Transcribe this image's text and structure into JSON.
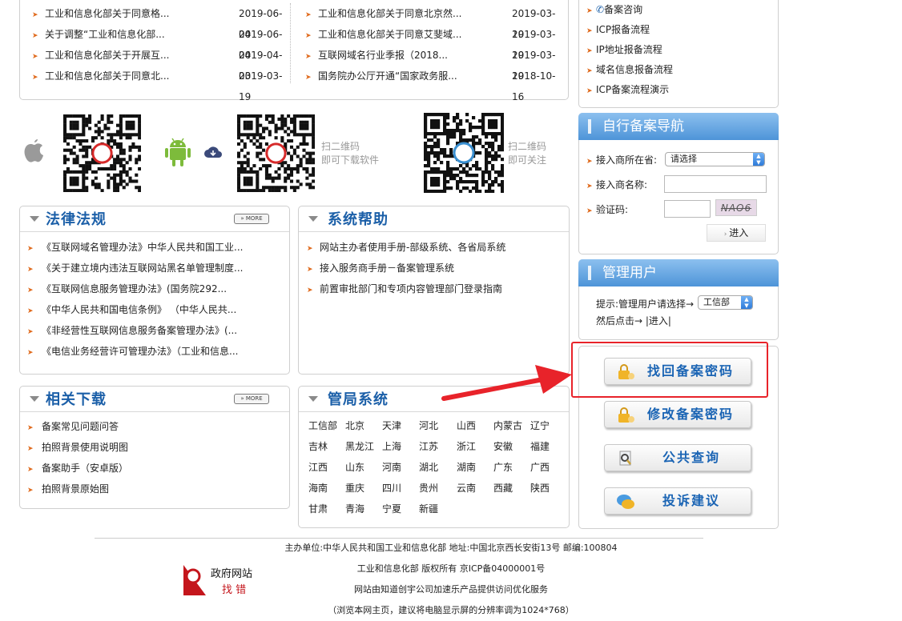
{
  "news": {
    "left": [
      {
        "title": "工业和信息化部关于同意格...",
        "date": "2019-06-04"
      },
      {
        "title": "关于调整“工业和信息化部...",
        "date": "2019-06-04"
      },
      {
        "title": "工业和信息化部关于开展互...",
        "date": "2019-04-03"
      },
      {
        "title": "工业和信息化部关于同意北...",
        "date": "2019-03-19"
      }
    ],
    "right": [
      {
        "title": "工业和信息化部关于同意北京然...",
        "date": "2019-03-19"
      },
      {
        "title": "工业和信息化部关于同意艾斐域...",
        "date": "2019-03-19"
      },
      {
        "title": "互联网域名行业季报（2018...",
        "date": "2019-03-19"
      },
      {
        "title": "国务院办公厅开通“国家政务服...",
        "date": "2018-10-16"
      }
    ]
  },
  "apps": {
    "download_line1": "扫二维码",
    "download_line2": "即可下载软件",
    "follow_line1": "扫二维码",
    "follow_line2": "即可关注"
  },
  "laws": {
    "title": "法律法规",
    "more": "MORE",
    "items": [
      "《互联网域名管理办法》中华人民共和国工业...",
      "《关于建立境内违法互联网站黑名单管理制度...",
      "《互联网信息服务管理办法》(国务院292...",
      "《中华人民共和国电信条例》 （中华人民共...",
      "《非经营性互联网信息服务备案管理办法》(...",
      "《电信业务经营许可管理办法》（工业和信息..."
    ]
  },
  "help": {
    "title": "系统帮助",
    "items": [
      "网站主办者使用手册-部级系统、各省局系统",
      "接入服务商手册－备案管理系统",
      "前置审批部门和专项内容管理部门登录指南"
    ]
  },
  "downloads": {
    "title": "相关下载",
    "more": "MORE",
    "items": [
      "备案常见问题问答",
      "拍照背景使用说明图",
      "备案助手（安卓版）",
      "拍照背景原始图"
    ]
  },
  "bureau": {
    "title": "管局系统",
    "cities": [
      [
        "工信部",
        "北京",
        "天津",
        "河北",
        "山西",
        "内蒙古",
        "辽宁"
      ],
      [
        "吉林",
        "黑龙江",
        "上海",
        "江苏",
        "浙江",
        "安徽",
        "福建"
      ],
      [
        "江西",
        "山东",
        "河南",
        "湖北",
        "湖南",
        "广东",
        "广西"
      ],
      [
        "海南",
        "重庆",
        "四川",
        "贵州",
        "云南",
        "西藏",
        "陕西"
      ],
      [
        "甘肃",
        "青海",
        "宁夏",
        "新疆"
      ]
    ]
  },
  "side_links": [
    "备案咨询",
    "ICP报备流程",
    "IP地址报备流程",
    "域名信息报备流程",
    "ICP备案流程演示"
  ],
  "self_nav": {
    "title": "自行备案导航",
    "province_label": "接入商所在省:",
    "province_value": "请选择",
    "name_label": "接入商名称:",
    "captcha_label": "验证码:",
    "captcha_text": "NAO6",
    "enter_label": "进入"
  },
  "admin": {
    "title": "管理用户",
    "hint": "提示:管理用户请选择→",
    "select_value": "工信部",
    "hint2": "然后点击→ |进入|"
  },
  "buttons": {
    "recover": "找回备案密码",
    "modify": "修改备案密码",
    "query": "公共查询",
    "complaint": "投诉建议"
  },
  "footer": {
    "line1": "主办单位:中华人民共和国工业和信息化部 地址:中国北京西长安街13号 邮编:100804",
    "line2": "工业和信息化部 版权所有 京ICP备04000001号",
    "line3": "网站由知道创宇公司加速乐产品提供访问优化服务",
    "line4": "（浏览本网主页，建议将电脑显示屏的分辨率调为1024*768）",
    "badge_top": "政府网站",
    "badge_bottom": "找 错"
  },
  "colors": {
    "accent_blue": "#1b5fa8",
    "arrow_red": "#e8232a",
    "bullet_orange": "#e06a1c"
  }
}
